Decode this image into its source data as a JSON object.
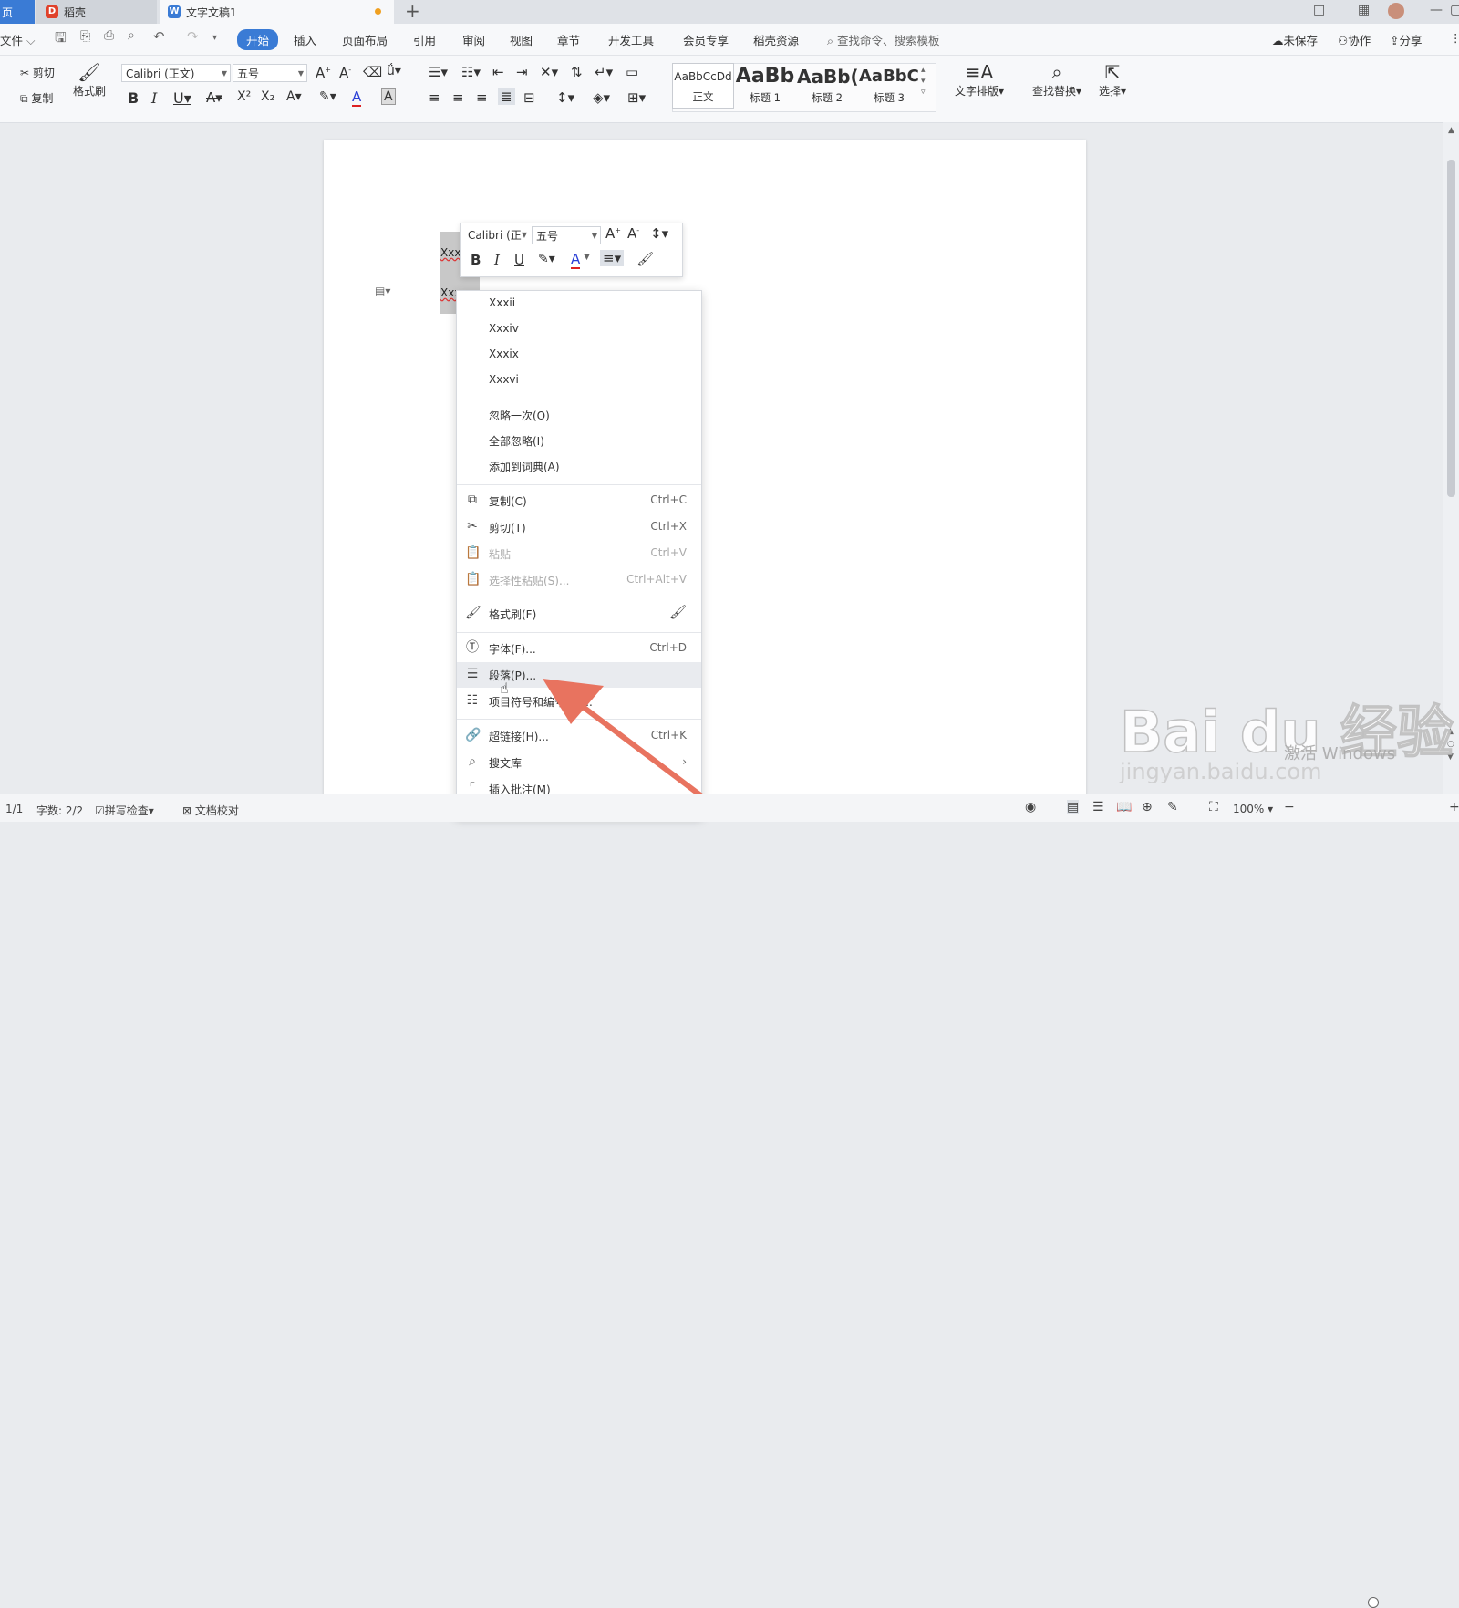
{
  "tabs": {
    "home": "页",
    "daoke": "稻壳",
    "doc": "文字文稿1"
  },
  "menu": {
    "file": "文件",
    "items": [
      "开始",
      "插入",
      "页面布局",
      "引用",
      "审阅",
      "视图",
      "章节",
      "开发工具",
      "会员专享",
      "稻壳资源"
    ],
    "search_placeholder": "查找命令、搜索模板",
    "unsaved": "未保存",
    "collab": "协作",
    "share": "分享"
  },
  "ribbon": {
    "cut": "剪切",
    "copy": "复制",
    "format_painter": "格式刷",
    "font": "Calibri (正文)",
    "size": "五号",
    "styles": [
      {
        "preview": "AaBbCcDd",
        "name": "正文"
      },
      {
        "preview": "AaBb",
        "name": "标题 1"
      },
      {
        "preview": "AaBb(",
        "name": "标题 2"
      },
      {
        "preview": "AaBbC(",
        "name": "标题 3"
      }
    ],
    "text_layout": "文字排版",
    "find_replace": "查找替换",
    "select": "选择"
  },
  "document": {
    "line1": "Xxxi",
    "line2": "Xxxv"
  },
  "minibar": {
    "font": "Calibri (正",
    "size": "五号"
  },
  "context_menu": {
    "suggestions": [
      "Xxxii",
      "Xxxiv",
      "Xxxix",
      "Xxxvi"
    ],
    "ignore_once": "忽略一次(O)",
    "ignore_all": "全部忽略(I)",
    "add_dict": "添加到词典(A)",
    "copy": {
      "label": "复制(C)",
      "shortcut": "Ctrl+C"
    },
    "cut": {
      "label": "剪切(T)",
      "shortcut": "Ctrl+X"
    },
    "paste": {
      "label": "粘贴",
      "shortcut": "Ctrl+V"
    },
    "paste_special": {
      "label": "选择性粘贴(S)...",
      "shortcut": "Ctrl+Alt+V"
    },
    "format_painter": {
      "label": "格式刷(F)"
    },
    "font": {
      "label": "字体(F)...",
      "shortcut": "Ctrl+D"
    },
    "paragraph": {
      "label": "段落(P)..."
    },
    "bullets": {
      "label": "项目符号和编号(N)..."
    },
    "hyperlink": {
      "label": "超链接(H)...",
      "shortcut": "Ctrl+K"
    },
    "search_lib": {
      "label": "搜文库"
    },
    "insert_comment": {
      "label": "插入批注(M)"
    }
  },
  "status": {
    "page": "1/1",
    "word_count": "字数: 2/2",
    "spell_check": "拼写检查",
    "doc_check": "文档校对",
    "zoom": "100%"
  },
  "watermark": {
    "brand": "Bai du 经验",
    "url": "jingyan.baidu.com",
    "activate": "激活 Windows"
  },
  "colors": {
    "accent": "#3a7bd5",
    "arrow": "#e8735f"
  }
}
